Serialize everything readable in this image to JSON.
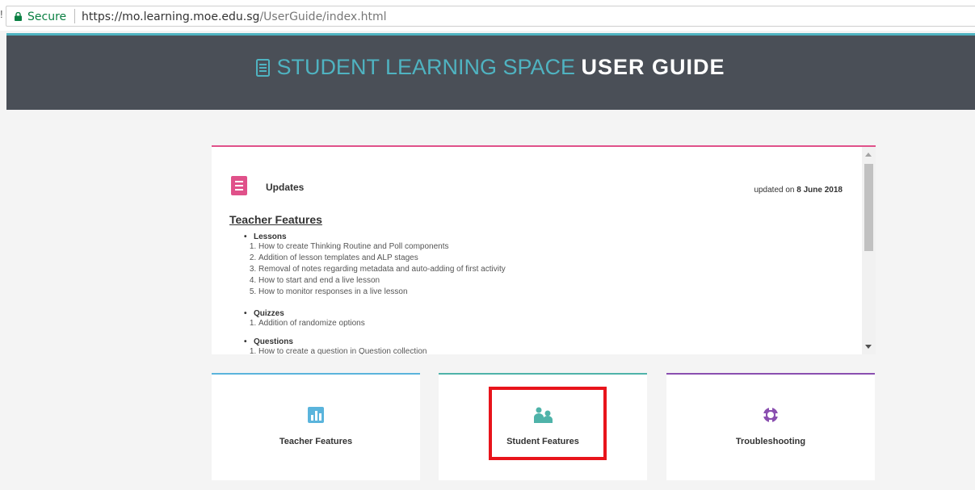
{
  "browser": {
    "secure_label": "Secure",
    "url_host": "https://mo.learning.moe.edu.sg",
    "url_path": "/UserGuide/index.html"
  },
  "header": {
    "title_light": "STUDENT LEARNING SPACE",
    "title_bold": "USER GUIDE",
    "icon": "document-icon"
  },
  "updates": {
    "title": "Updates",
    "date_prefix": "updated on",
    "date": "8 June 2018",
    "section_link": "Teacher Features",
    "sections": [
      {
        "title": "Lessons",
        "items": [
          "How to create Thinking Routine and Poll components",
          "Addition of lesson templates and ALP stages",
          "Removal of notes regarding metadata and auto-adding of first activity",
          "How to start and end a live lesson",
          "How to monitor responses in a live lesson"
        ]
      },
      {
        "title": "Quizzes",
        "items": [
          "Addition of randomize options"
        ]
      },
      {
        "title": "Questions",
        "items": [
          "How to create a question in Question collection"
        ]
      }
    ]
  },
  "cards": [
    {
      "label": "Teacher Features",
      "icon": "bar-chart-icon",
      "color": "#5ab4dc"
    },
    {
      "label": "Student Features",
      "icon": "users-icon",
      "color": "#4fb3a9"
    },
    {
      "label": "Troubleshooting",
      "icon": "lifebuoy-icon",
      "color": "#8a4fb0"
    }
  ],
  "colors": {
    "accent_teal": "#4fb3c1",
    "updates_pink": "#e0518a",
    "highlight_red": "#e8141b",
    "banner_bg": "#4a4f57"
  }
}
